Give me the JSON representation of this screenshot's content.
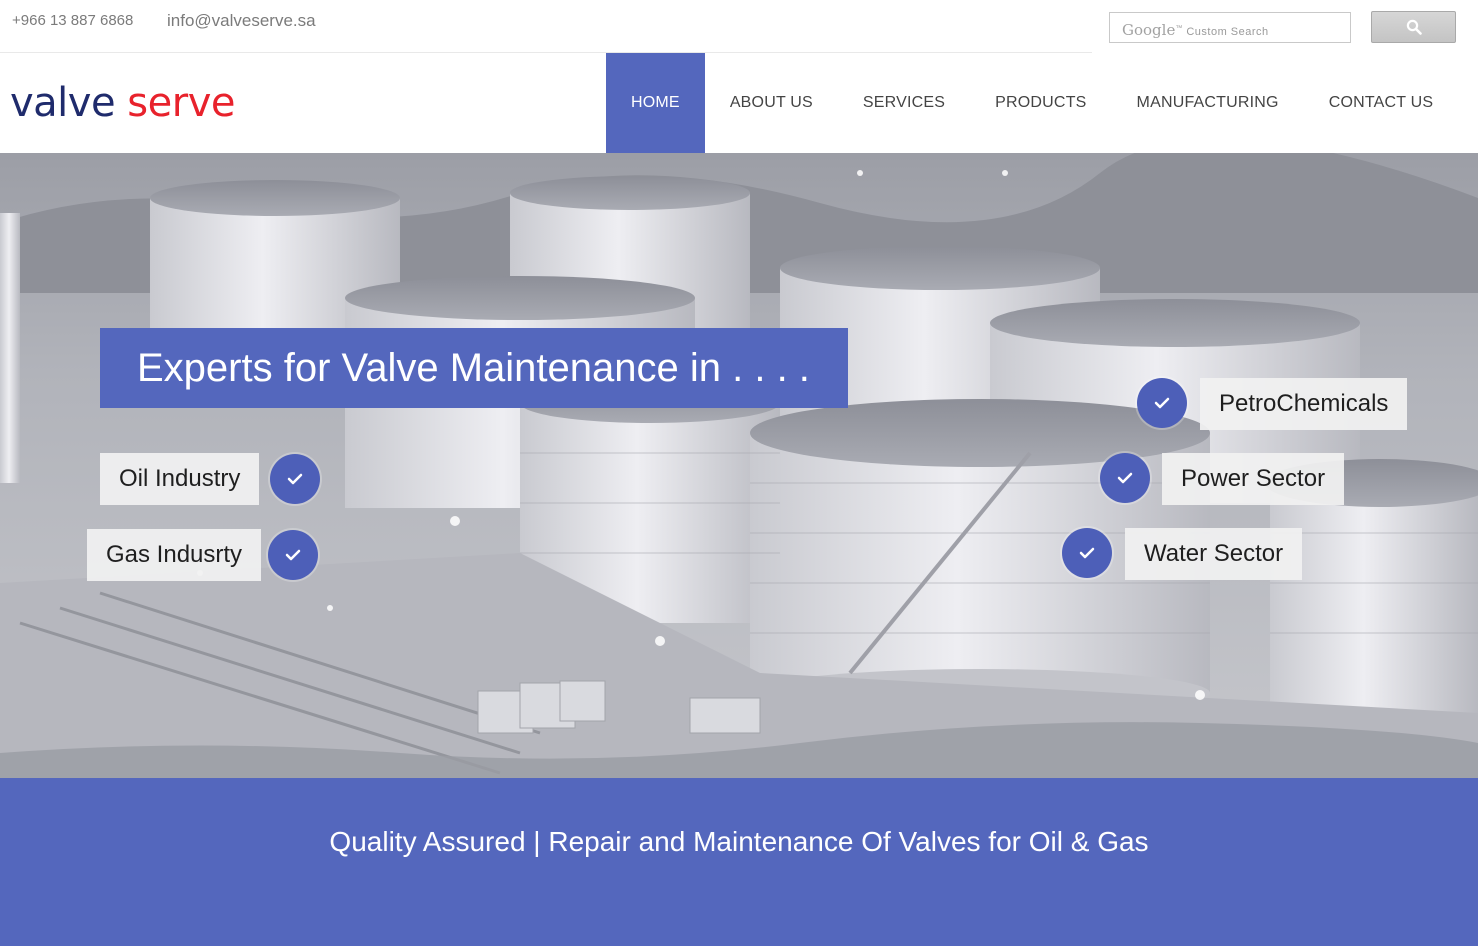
{
  "topbar": {
    "phone": "+966 13 887 6868",
    "email": "info@valveserve.sa"
  },
  "search": {
    "google_label": "Google",
    "tm": "™",
    "placeholder": "Custom Search",
    "button_icon": "search-icon"
  },
  "logo": {
    "part1": "valve",
    "part2": " serve"
  },
  "nav": {
    "items": [
      {
        "label": "HOME",
        "active": true
      },
      {
        "label": "ABOUT US"
      },
      {
        "label": "SERVICES"
      },
      {
        "label": "PRODUCTS"
      },
      {
        "label": "MANUFACTURING"
      },
      {
        "label": "CONTACT US"
      }
    ]
  },
  "hero": {
    "headline": "Experts for Valve Maintenance in . . . .",
    "left_tags": [
      "Oil Industry",
      "Gas Indusrty"
    ],
    "right_tags": [
      "PetroChemicals",
      "Power Sector",
      "Water Sector"
    ]
  },
  "band": {
    "tagline": "Quality Assured | Repair and Maintenance Of Valves for Oil & Gas"
  },
  "colors": {
    "accent": "#5467bd",
    "logo_blue": "#1f2b6c",
    "logo_red": "#e8222c"
  }
}
